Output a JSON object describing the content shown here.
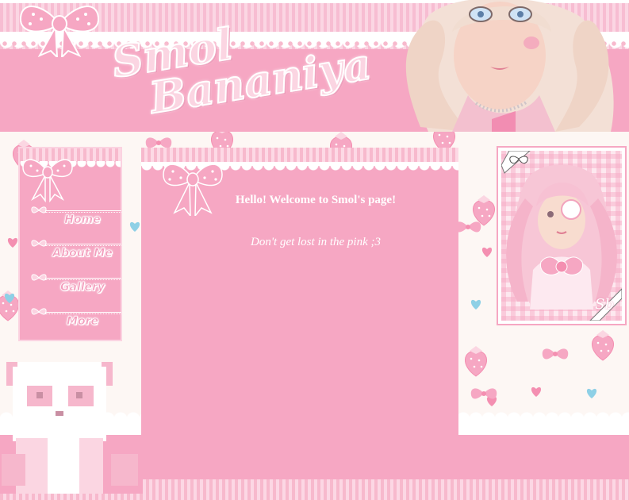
{
  "header": {
    "title_line1": "Smol",
    "title_line2": "Bananiya"
  },
  "nav": {
    "items": [
      {
        "label": "Home"
      },
      {
        "label": "About Me"
      },
      {
        "label": "Gallery"
      },
      {
        "label": "More"
      }
    ]
  },
  "main": {
    "welcome": "Hello! Welcome to Smol's page!",
    "tagline": "Don't get lost in the pink ;3"
  },
  "portrait": {
    "signature": "Sb"
  },
  "colors": {
    "primary_pink": "#f6a7c3",
    "light_pink": "#fbd3e1",
    "background": "#fdf7f4",
    "text": "#ffffff"
  },
  "icons": [
    "bow-icon",
    "heart-icon",
    "strawberry-icon",
    "panda-icon"
  ]
}
